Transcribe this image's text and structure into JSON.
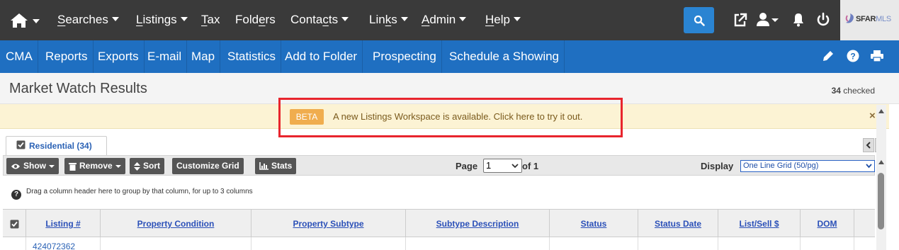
{
  "topnav": {
    "items": [
      {
        "label": "Searches",
        "accel": "S",
        "rest": "earches",
        "caret": true
      },
      {
        "label": "Listings",
        "accel": "L",
        "rest": "istings",
        "caret": true
      },
      {
        "label": "Tax",
        "accel": "T",
        "rest": "ax",
        "caret": false
      },
      {
        "label": "Folders",
        "caret": false
      },
      {
        "label": "Contacts",
        "caret": true
      },
      {
        "label": "Links",
        "caret": true
      },
      {
        "label": "Admin",
        "accel": "A",
        "rest": "dmin",
        "caret": true
      },
      {
        "label": "Help",
        "accel": "H",
        "rest": "elp",
        "caret": true
      }
    ],
    "contacts_pre": "Conta",
    "contacts_accel": "c",
    "contacts_post": "ts",
    "links_pre": "Lin",
    "links_accel": "k",
    "links_post": "s",
    "folders_pre": "Fold",
    "folders_accel": "e",
    "folders_post": "rs",
    "logo_text": "SFAR",
    "logo_ml": "MLS"
  },
  "actionbar": {
    "items": [
      "CMA",
      "Reports",
      "Exports",
      "E-mail",
      "Map",
      "Statistics",
      "Add to Folder",
      "Prospecting",
      "Schedule a Showing"
    ]
  },
  "header": {
    "title": "Market Watch Results",
    "checked_count": "34",
    "checked_suffix": " checked"
  },
  "banner": {
    "badge": "BETA",
    "message": "A new Listings Workspace is available. Click here to try it out.",
    "close": "×"
  },
  "tabs": [
    {
      "label": "Residential (34)",
      "checked": true
    }
  ],
  "toolbar": {
    "show_label": "Show",
    "remove_label": "Remove",
    "sort_label": "Sort",
    "customize_label": "Customize Grid",
    "stats_label": "Stats",
    "page_label": "Page",
    "page_value": "1",
    "page_of": "of 1",
    "display_label": "Display",
    "display_value": "One Line Grid (50/pg)"
  },
  "grid": {
    "group_hint": "Drag a column header here to group by that column, for up to 3 columns",
    "columns": [
      "Listing #",
      "Property Condition",
      "Property Subtype",
      "Subtype Description",
      "Status",
      "Status Date",
      "List/Sell $",
      "DOM"
    ],
    "rows": [
      {
        "listing": "424072362"
      }
    ]
  },
  "colors": {
    "topnav_bg": "#3a3a3a",
    "actionbar_bg": "#1f6fc1",
    "search_btn": "#2a84d2",
    "beta_badge": "#f0ad4e",
    "banner_bg": "#fcf3d4",
    "highlight_border": "#e8252d",
    "link": "#2b62b5"
  }
}
